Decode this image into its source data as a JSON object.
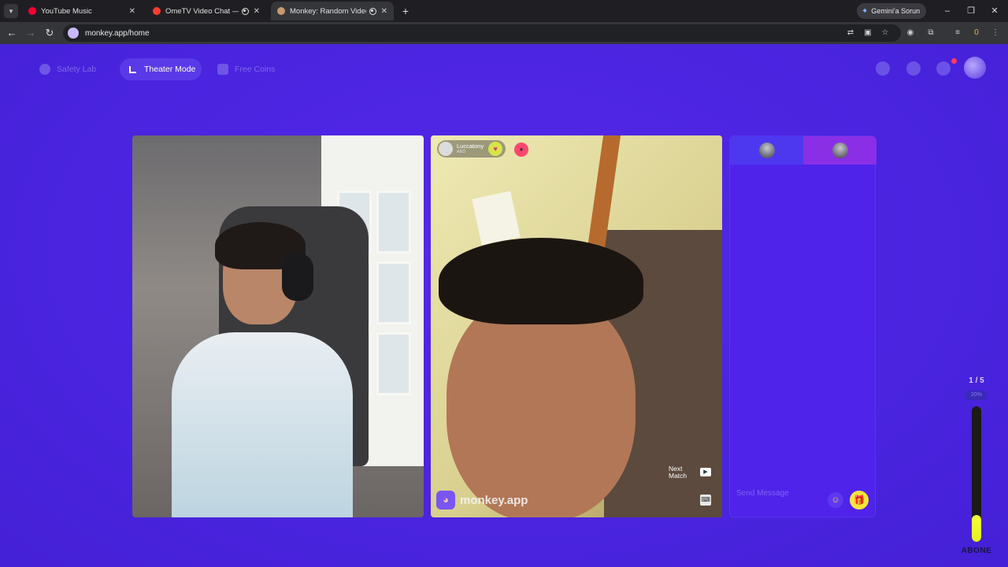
{
  "browser": {
    "tabs": [
      {
        "title": "YouTube Music",
        "icon": "youtube-music-icon",
        "active": false
      },
      {
        "title": "OmeTV Video Chat — Ome",
        "icon": "ometv-icon",
        "active": false
      },
      {
        "title": "Monkey: Random Video Ch",
        "icon": "monkey-icon",
        "active": true
      }
    ],
    "gemini_label": "Gemini'a Sorun",
    "url": "monkey.app/home",
    "extension_badge": "0"
  },
  "topnav": {
    "safety_lab": "Safety Lab",
    "theater_mode": "Theater Mode",
    "free_coins": "Free Coins"
  },
  "match": {
    "username": "Luccatony",
    "country": "ABD",
    "brand": "monkey.app",
    "next_match": "Next Match"
  },
  "chat": {
    "placeholder": "Send Message"
  },
  "progress": {
    "count": "1 / 5",
    "percent_label": "20%",
    "fill_fraction": 0.2,
    "label": "ABONE"
  },
  "colors": {
    "background": "#4a25e0",
    "accent": "#f3ff3a",
    "chat_tab_active": "#8a2fe6"
  }
}
